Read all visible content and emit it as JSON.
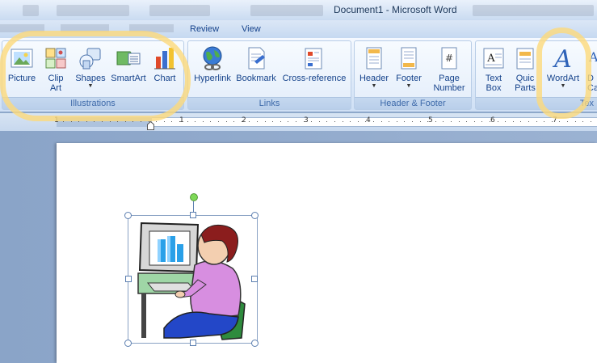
{
  "window": {
    "title": "Document1 - Microsoft Word"
  },
  "tabs": [
    {
      "label": "Review"
    },
    {
      "label": "View"
    }
  ],
  "ribbon": {
    "groups": {
      "illustrations": {
        "label": "Illustrations",
        "buttons": [
          {
            "label": "Picture",
            "icon": "picture-icon"
          },
          {
            "label": "Clip",
            "label2": "Art",
            "icon": "clip-art-icon"
          },
          {
            "label": "Shapes",
            "icon": "shapes-icon",
            "dropdown": true
          },
          {
            "label": "SmartArt",
            "icon": "smartart-icon"
          },
          {
            "label": "Chart",
            "icon": "chart-icon"
          }
        ]
      },
      "links": {
        "label": "Links",
        "buttons": [
          {
            "label": "Hyperlink",
            "icon": "hyperlink-icon"
          },
          {
            "label": "Bookmark",
            "icon": "bookmark-icon"
          },
          {
            "label": "Cross-reference",
            "icon": "cross-reference-icon"
          }
        ]
      },
      "header_footer": {
        "label": "Header & Footer",
        "buttons": [
          {
            "label": "Header",
            "icon": "header-icon",
            "dropdown": true
          },
          {
            "label": "Footer",
            "icon": "footer-icon",
            "dropdown": true
          },
          {
            "label": "Page",
            "label2": "Number",
            "icon": "page-number-icon",
            "dropdown": true
          }
        ]
      },
      "text": {
        "label": "Tex",
        "buttons": [
          {
            "label": "Text",
            "label2": "Box",
            "icon": "text-box-icon",
            "dropdown": true
          },
          {
            "label": "Quic",
            "label2": "Parts",
            "icon": "quick-parts-icon"
          },
          {
            "label": "WordArt",
            "icon": "wordart-icon",
            "dropdown": true
          },
          {
            "label": "D",
            "label2": "Ca",
            "icon": "drop-cap-icon"
          }
        ]
      }
    }
  },
  "ruler": {
    "numbers": [
      "1",
      "1",
      "2",
      "3",
      "4",
      "5",
      "6",
      "7"
    ]
  },
  "document": {
    "image": {
      "icon": "woman-at-computer-clipart"
    }
  },
  "annotation_color": "#fcd97a"
}
